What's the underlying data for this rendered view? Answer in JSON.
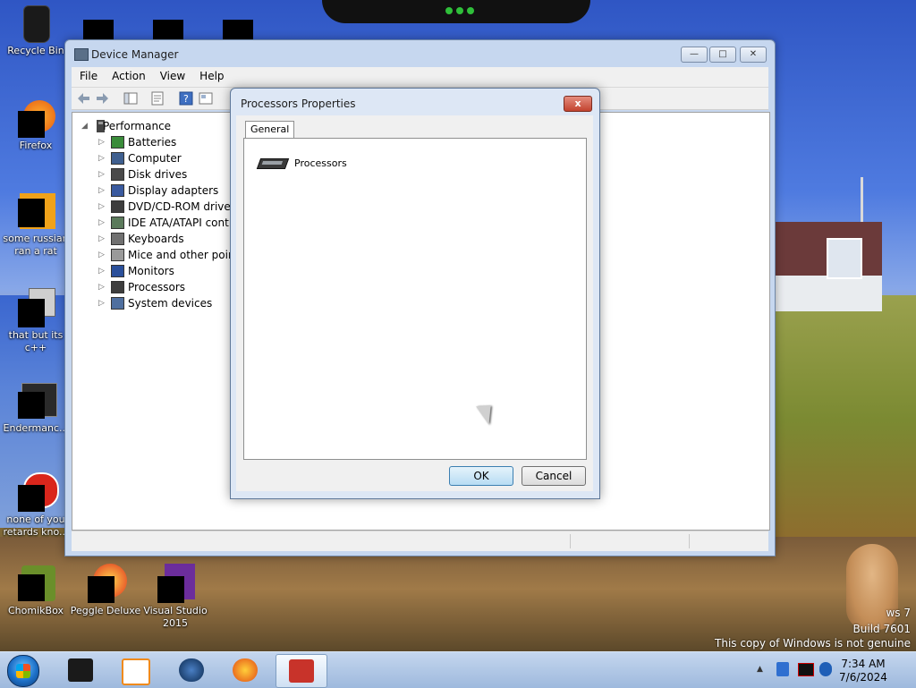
{
  "desktop": {
    "icons": [
      {
        "label": "Recycle Bin"
      },
      {
        "label": "Firefox"
      },
      {
        "label": "some russian ran a rat"
      },
      {
        "label": "that but its c++"
      },
      {
        "label": "Endermanc..."
      },
      {
        "label": "none of you retards kno..."
      },
      {
        "label": "ChomikBox"
      },
      {
        "label": "Peggle Deluxe"
      },
      {
        "label": "Visual Studio 2015"
      }
    ],
    "watermark": {
      "line1": "ws 7",
      "line2": "Build 7601",
      "line3": "This copy of Windows is not genuine"
    }
  },
  "device_manager": {
    "title": "Device Manager",
    "menu": [
      "File",
      "Action",
      "View",
      "Help"
    ],
    "tree": {
      "root": "Performance",
      "children": [
        "Batteries",
        "Computer",
        "Disk drives",
        "Display adapters",
        "DVD/CD-ROM drives",
        "IDE ATA/ATAPI contro",
        "Keyboards",
        "Mice and other pointi",
        "Monitors",
        "Processors",
        "System devices"
      ]
    }
  },
  "dialog": {
    "title": "Processors Properties",
    "close_label": "x",
    "tab": "General",
    "device_label": "Processors",
    "ok_label": "OK",
    "cancel_label": "Cancel"
  },
  "taskbar": {
    "time": "7:34 AM",
    "date": "7/6/2024"
  },
  "colors": {
    "accent": "#3c7fb1",
    "close_red": "#c2432f"
  }
}
